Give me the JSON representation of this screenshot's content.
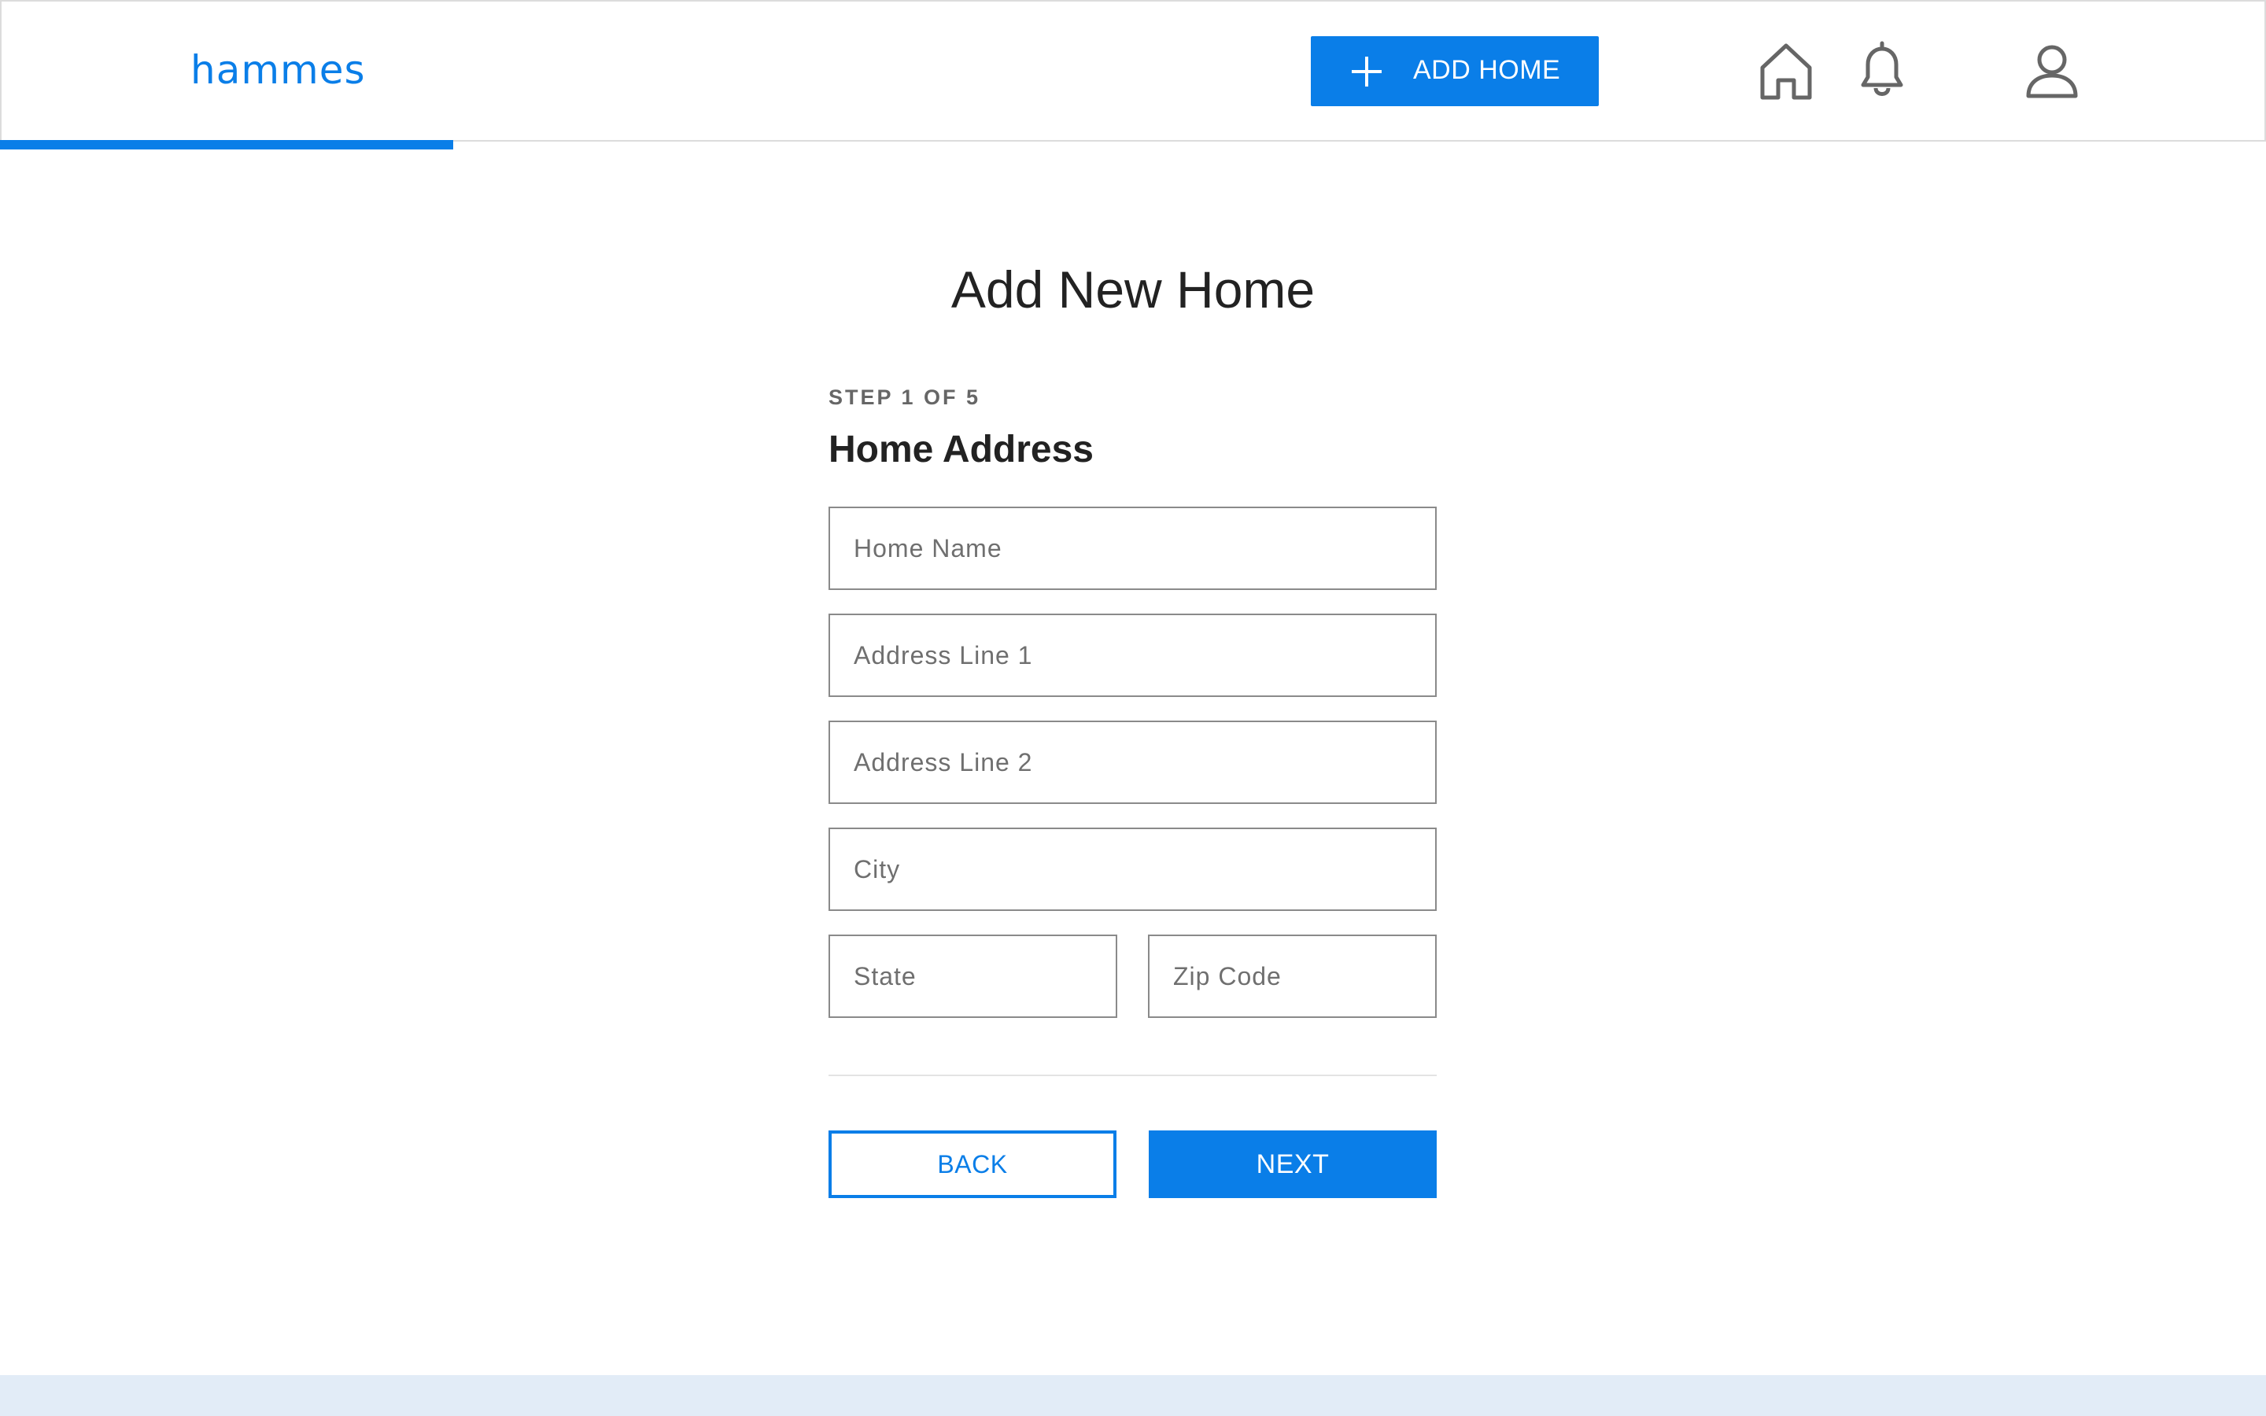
{
  "header": {
    "logo": "hammes",
    "add_home_label": "ADD HOME",
    "icons": [
      "home-icon",
      "bell-icon",
      "user-icon"
    ]
  },
  "progress": {
    "step": 1,
    "total": 5,
    "fraction": 0.2
  },
  "page": {
    "title": "Add New Home",
    "step_label": "STEP 1 OF 5",
    "section_title": "Home Address"
  },
  "form": {
    "home_name": {
      "placeholder": "Home Name",
      "value": ""
    },
    "address_line_1": {
      "placeholder": "Address Line 1",
      "value": ""
    },
    "address_line_2": {
      "placeholder": "Address Line 2",
      "value": ""
    },
    "city": {
      "placeholder": "City",
      "value": ""
    },
    "state": {
      "placeholder": "State",
      "value": ""
    },
    "zip": {
      "placeholder": "Zip Code",
      "value": ""
    }
  },
  "actions": {
    "back_label": "BACK",
    "next_label": "NEXT"
  },
  "colors": {
    "accent": "#0a7ee8",
    "footer": "#e2ecf7",
    "icon": "#666666"
  }
}
